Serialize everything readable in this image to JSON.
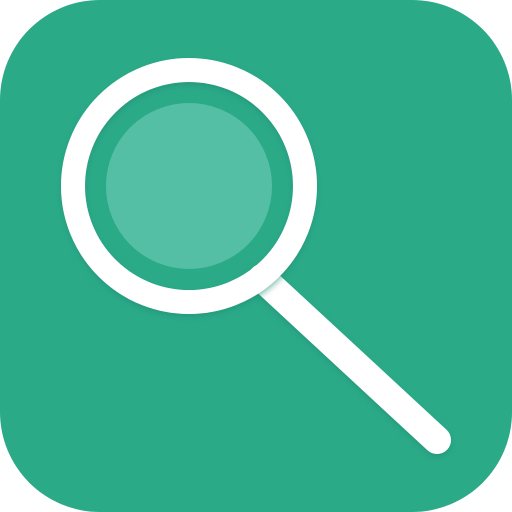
{
  "app_icon": {
    "icon": "magnifying-glass-icon",
    "colors": {
      "background": "#2BAA88",
      "glass": "#55BFA5",
      "frame": "#FFFFFF",
      "shadow": "#1F8C70"
    }
  }
}
